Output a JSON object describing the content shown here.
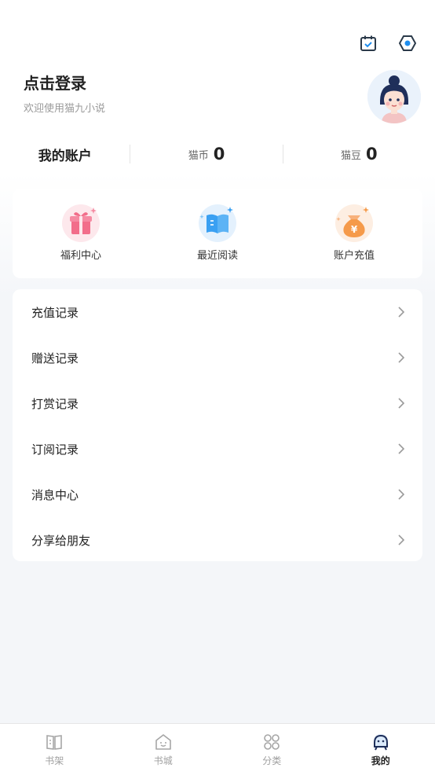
{
  "header": {
    "login_text": "点击登录",
    "welcome_text": "欢迎使用猫九小说"
  },
  "account": {
    "title": "我的账户",
    "coin_label": "猫币",
    "coin_value": "0",
    "bean_label": "猫豆",
    "bean_value": "0"
  },
  "quick_actions": [
    {
      "label": "福利中心",
      "icon": "gift-icon"
    },
    {
      "label": "最近阅读",
      "icon": "book-icon"
    },
    {
      "label": "账户充值",
      "icon": "money-bag-icon"
    }
  ],
  "menu": [
    {
      "label": "充值记录"
    },
    {
      "label": "赠送记录"
    },
    {
      "label": "打赏记录"
    },
    {
      "label": "订阅记录"
    },
    {
      "label": "消息中心"
    },
    {
      "label": "分享给朋友"
    }
  ],
  "tabbar": [
    {
      "label": "书架",
      "icon": "bookshelf-icon"
    },
    {
      "label": "书城",
      "icon": "bookstore-icon"
    },
    {
      "label": "分类",
      "icon": "category-icon"
    },
    {
      "label": "我的",
      "icon": "profile-icon",
      "active": true
    }
  ],
  "colors": {
    "accent": "#1e8ef0",
    "gift": "#f26d8a",
    "book": "#3aa0f2",
    "money": "#f59a4a"
  }
}
